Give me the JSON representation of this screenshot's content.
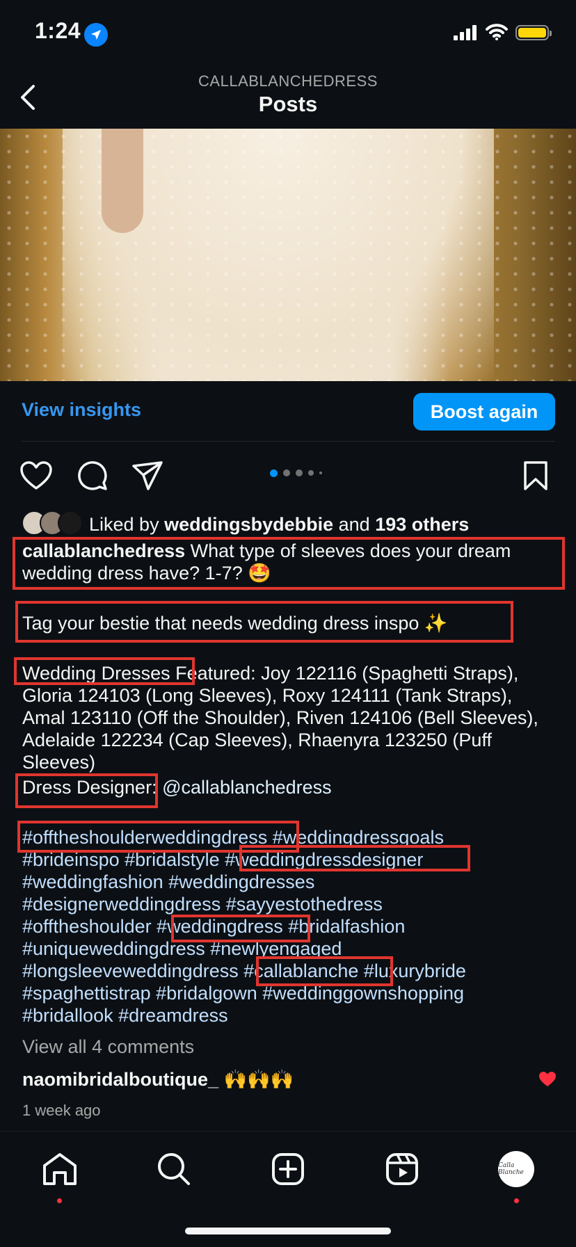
{
  "status_bar": {
    "time": "1:24"
  },
  "header": {
    "account": "CALLABLANCHEDRESS",
    "title": "Posts"
  },
  "actions": {
    "view_insights": "View insights",
    "boost": "Boost again"
  },
  "likes": {
    "prefix": "Liked by",
    "user": "weddingsbydebbie",
    "middle": "and",
    "others": "193 others"
  },
  "caption": {
    "username": "callablanchedress",
    "text": "What type of sleeves does your dream wedding dress have? 1-7? 🤩",
    "tag_line": "Tag your bestie that needs wedding dress inspo ✨",
    "dresses": "Wedding Dresses Featured: Joy 122116 (Spaghetti Straps), Gloria 124103 (Long Sleeves), Roxy 124111 (Tank Straps), Amal 123110 (Off the Shoulder), Riven 124106 (Bell Sleeves), Adelaide 122234 (Cap Sleeves), Rhaenyra 123250 (Puff Sleeves)",
    "designer_label": "Dress Designer:",
    "designer_handle": "@callablanchedress",
    "hashtags": [
      "#offtheshoulderweddingdress",
      "#weddingdressgoals",
      "#brideinspo",
      "#bridalstyle",
      "#weddingdressdesigner",
      "#weddingfashion",
      "#weddingdresses",
      "#designerweddingdress",
      "#sayyestothedress",
      "#offtheshoulder",
      "#weddingdress",
      "#bridalfashion",
      "#uniqueweddingdress",
      "#newlyengaged",
      "#longsleeveweddingdress",
      "#callablanche",
      "#luxurybride",
      "#spaghettistrap",
      "#bridalgown",
      "#weddinggownshopping",
      "#bridallook",
      "#dreamdress"
    ]
  },
  "comments": {
    "view_all": "View all 4 comments",
    "first_user": "naomibridalboutique_",
    "first_text": "🙌🙌🙌",
    "timestamp": "1 week ago"
  },
  "profile_avatar_text": "Calla Blanche",
  "colors": {
    "background": "#0c1014",
    "link": "#3797f0",
    "button": "#0095f6",
    "annotation": "#e0352f",
    "like": "#ff3040"
  }
}
